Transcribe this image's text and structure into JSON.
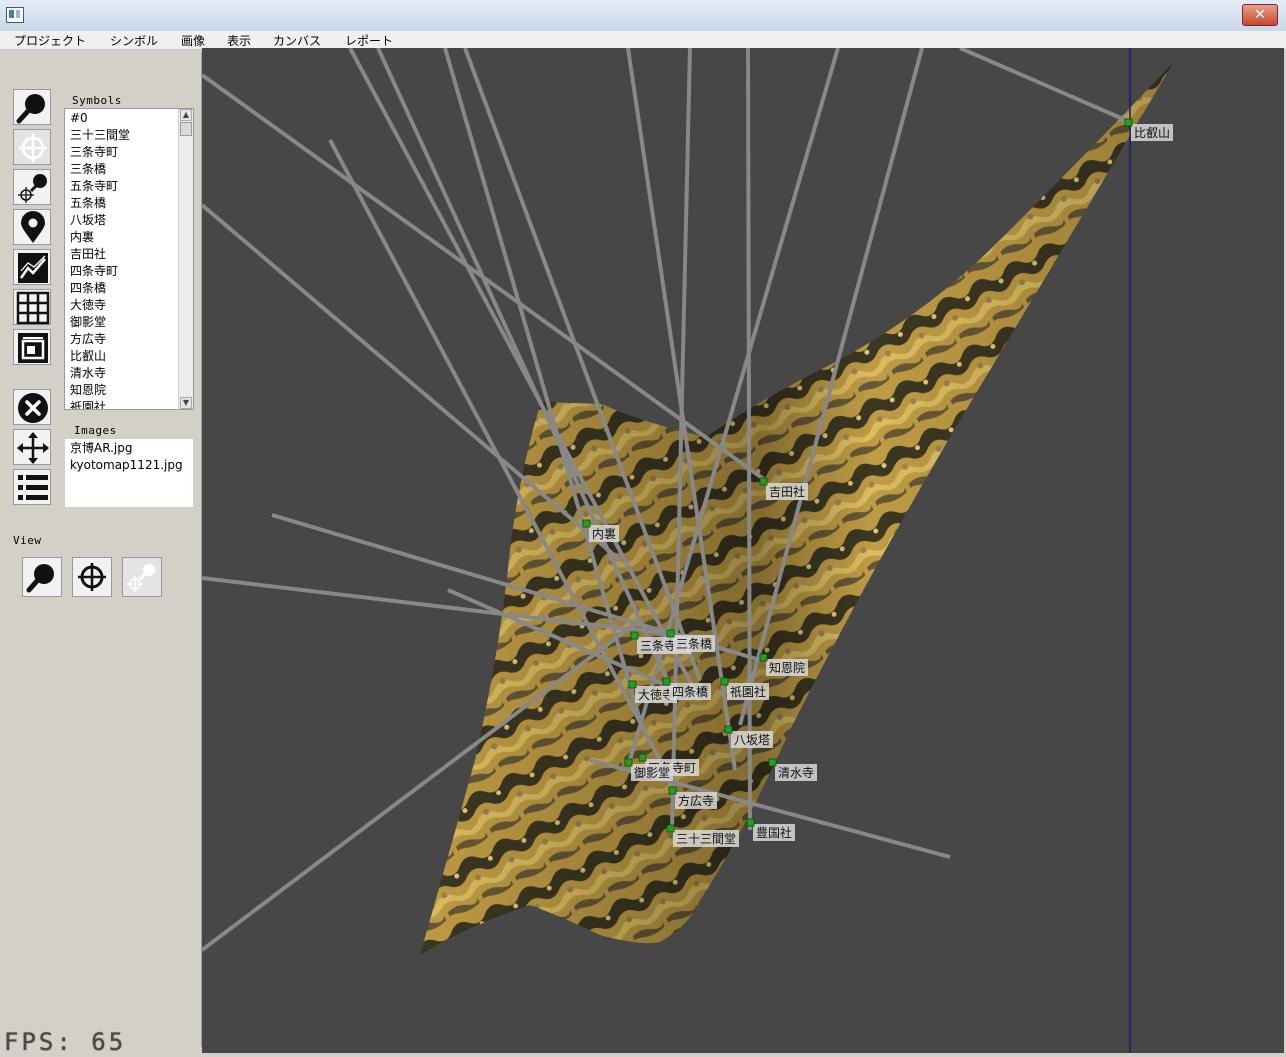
{
  "window": {
    "close_glyph": "✕"
  },
  "menu": [
    "プロジェクト",
    "シンボル",
    "画像",
    "表示",
    "カンバス",
    "レポート"
  ],
  "panels": {
    "symbols_label": "Symbols",
    "images_label": "Images",
    "view_label": "View"
  },
  "symbols": [
    "#0",
    "三十三間堂",
    "三条寺町",
    "三条橋",
    "五条寺町",
    "五条橋",
    "八坂塔",
    "内裏",
    "吉田社",
    "四条寺町",
    "四条橋",
    "大徳寺",
    "御影堂",
    "方広寺",
    "比叡山",
    "清水寺",
    "知恩院",
    "祇園社"
  ],
  "images": [
    "京博AR.jpg",
    "kyotomap1121.jpg"
  ],
  "tools": [
    {
      "name": "zoom-tool-button",
      "icon": "magnifier-icon"
    },
    {
      "name": "crosshair-tool-button",
      "icon": "crosshair-icon"
    },
    {
      "name": "zoom-crosshair-tool-button",
      "icon": "zoom-crosshair-icon"
    },
    {
      "name": "marker-tool-button",
      "icon": "map-pin-icon"
    },
    {
      "name": "graph-tool-button",
      "icon": "line-graph-icon"
    },
    {
      "name": "grid-tool-button",
      "icon": "grid-icon"
    },
    {
      "name": "frame-tool-button",
      "icon": "frame-icon"
    },
    {
      "name": "delete-tool-button",
      "icon": "close-circle-icon"
    },
    {
      "name": "move-tool-button",
      "icon": "move-arrows-icon"
    },
    {
      "name": "list-tool-button",
      "icon": "bullet-list-icon"
    }
  ],
  "view_buttons": [
    {
      "name": "view-zoom-button",
      "icon": "magnifier-icon"
    },
    {
      "name": "view-crosshair-button",
      "icon": "crosshair-icon"
    },
    {
      "name": "view-zoom-crosshair-button",
      "icon": "zoom-crosshair-icon"
    }
  ],
  "map_markers": [
    "比叡山",
    "吉田社",
    "内裏",
    "三条寺町",
    "三条橋",
    "知恩院",
    "大徳寺",
    "四条橋",
    "祇園社",
    "八坂塔",
    "四条寺町",
    "御影堂",
    "清水寺",
    "方広寺",
    "三十三間堂",
    "豊国社"
  ],
  "status": {
    "fps": "FPS: 65"
  },
  "colors": {
    "canvas_bg": "#474747",
    "marker": "#1fa31f",
    "ray": "#888888",
    "guide_line": "#1a1a7a"
  }
}
